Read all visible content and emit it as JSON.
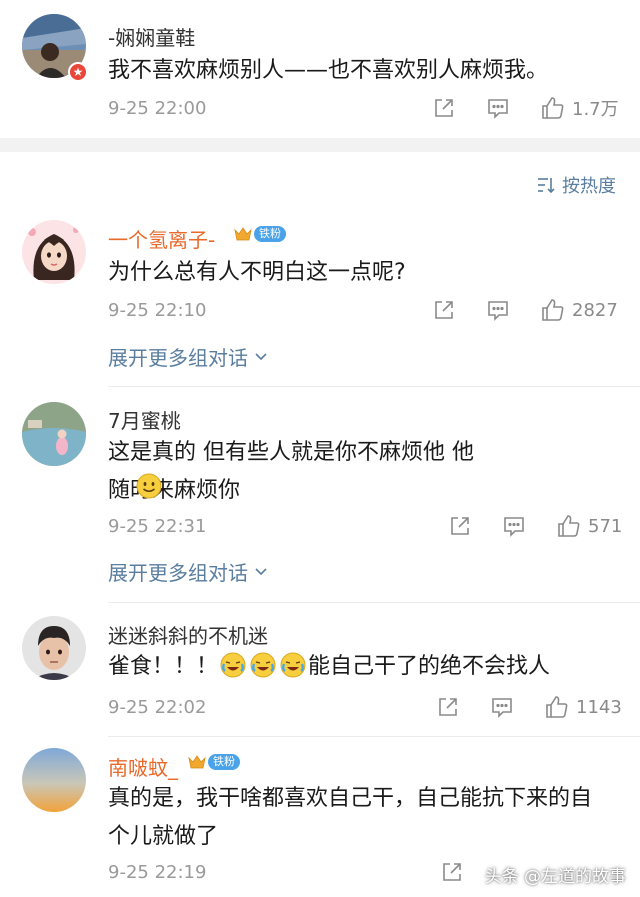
{
  "post": {
    "username": "-娴娴童鞋",
    "text": "我不喜欢麻烦别人——也不喜欢别人麻烦我。",
    "time": "9-25 22:00",
    "likes": "1.7万"
  },
  "sort_label": "按热度",
  "badge_label": "铁粉",
  "expand_label": "展开更多组对话",
  "comments": [
    {
      "username": "一个氢离子-",
      "text": "为什么总有人不明白这一点呢?",
      "time": "9-25 22:10",
      "likes": "2827"
    },
    {
      "username": "7月蜜桃",
      "text": "这是真的 但有些人就是你不麻烦他 他随时来麻烦你",
      "time": "9-25 22:31",
      "likes": "571"
    },
    {
      "username": "迷迷斜斜的不机迷",
      "text_prefix": "雀食！！！",
      "text_suffix": "能自己干了的绝不会找人",
      "time": "9-25 22:02",
      "likes": "1143"
    },
    {
      "username": "南啵蚊_",
      "text": "真的是，我干啥都喜欢自己干，自己能抗下来的自个儿就做了",
      "time": "9-25 22:19",
      "likes": ""
    }
  ],
  "watermark": "头条 @左道的故事",
  "colors": {
    "link": "#5a7ea0",
    "vip_name": "#e86a2a",
    "badge": "#4aa3e8",
    "meta": "#9a9a9a"
  }
}
